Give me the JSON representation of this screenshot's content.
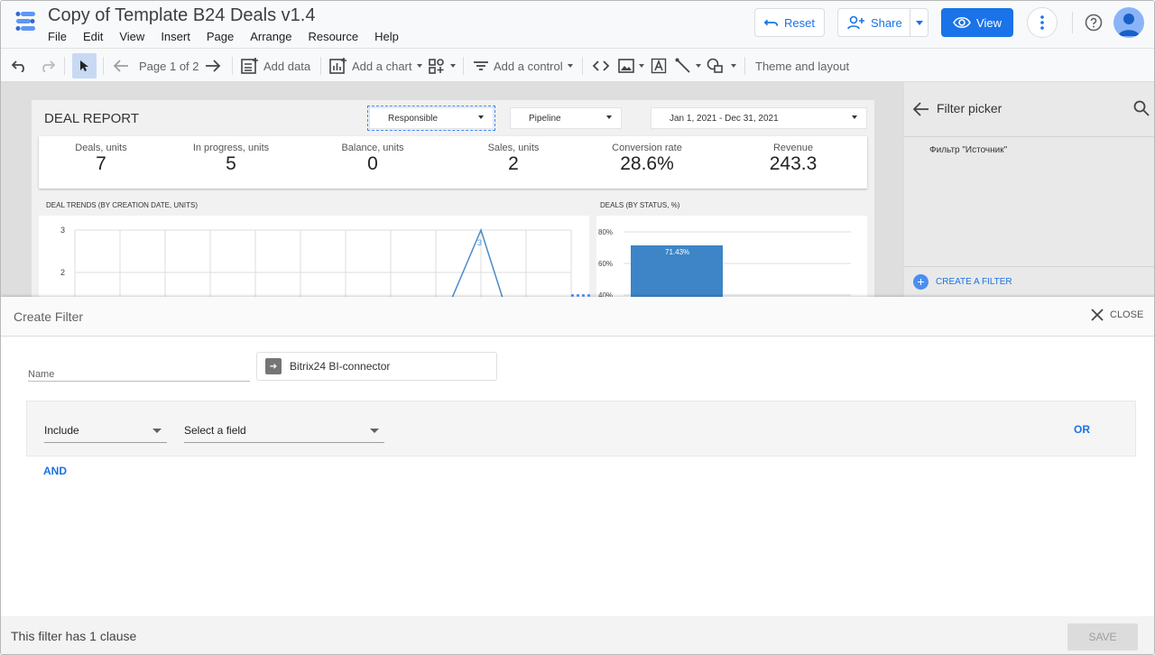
{
  "app": {
    "title": "Copy of Template B24 Deals v1.4"
  },
  "menu": [
    "File",
    "Edit",
    "View",
    "Insert",
    "Page",
    "Arrange",
    "Resource",
    "Help"
  ],
  "header_buttons": {
    "reset": "Reset",
    "share": "Share",
    "view": "View"
  },
  "toolbar": {
    "page_indicator": "Page 1 of 2",
    "add_data": "Add data",
    "add_chart": "Add a chart",
    "add_control": "Add a control",
    "theme": "Theme and layout"
  },
  "report": {
    "title": "DEAL REPORT",
    "filters": {
      "responsible": "Responsible",
      "pipeline": "Pipeline",
      "date_range": "Jan 1, 2021 - Dec 31, 2021"
    },
    "kpis": [
      {
        "label": "Deals, units",
        "value": "7"
      },
      {
        "label": "In progress, units",
        "value": "5"
      },
      {
        "label": "Balance, units",
        "value": "0"
      },
      {
        "label": "Sales, units",
        "value": "2"
      },
      {
        "label": "Conversion rate",
        "value": "28.6%"
      },
      {
        "label": "Revenue",
        "value": "243.3"
      }
    ],
    "trend_title": "DEAL TRENDS (BY CREATION DATE, UNITS)",
    "status_title": "DEALS (BY STATUS, %)"
  },
  "chart_data": [
    {
      "type": "line",
      "title": "DEAL TRENDS (BY CREATION DATE, UNITS)",
      "y_ticks": [
        "3",
        "2"
      ],
      "peak_label": "3"
    },
    {
      "type": "bar",
      "title": "DEALS (BY STATUS, %)",
      "y_ticks": [
        "80%",
        "60%",
        "40%"
      ],
      "values": [
        71.43
      ],
      "value_labels": [
        "71.43%"
      ]
    }
  ],
  "filter_picker": {
    "title": "Filter picker",
    "item": "Фильтр \"Источник\"",
    "create": "CREATE A FILTER"
  },
  "create_filter": {
    "title": "Create Filter",
    "close": "CLOSE",
    "name_label": "Name",
    "data_source": "Bitrix24 BI-connector",
    "include": "Include",
    "field_placeholder": "Select a field",
    "or": "OR",
    "and": "AND",
    "footer_text": "This filter has 1 clause",
    "save": "SAVE"
  },
  "colors": {
    "accent": "#1a73e8",
    "bar": "#3d85c6",
    "line": "#4a8bc9"
  },
  "icons": [
    "undo-icon",
    "redo-icon",
    "select-icon",
    "prev-page-icon",
    "next-page-icon",
    "add-data-icon",
    "add-chart-icon",
    "community-viz-icon",
    "control-icon",
    "code-icon",
    "image-icon",
    "text-icon",
    "line-icon",
    "shape-icon",
    "reset-icon",
    "add-person-icon",
    "eye-icon",
    "more-vert-icon",
    "help-icon",
    "avatar-icon",
    "back-arrow-icon",
    "search-icon",
    "plus-icon",
    "close-icon",
    "data-source-icon"
  ]
}
